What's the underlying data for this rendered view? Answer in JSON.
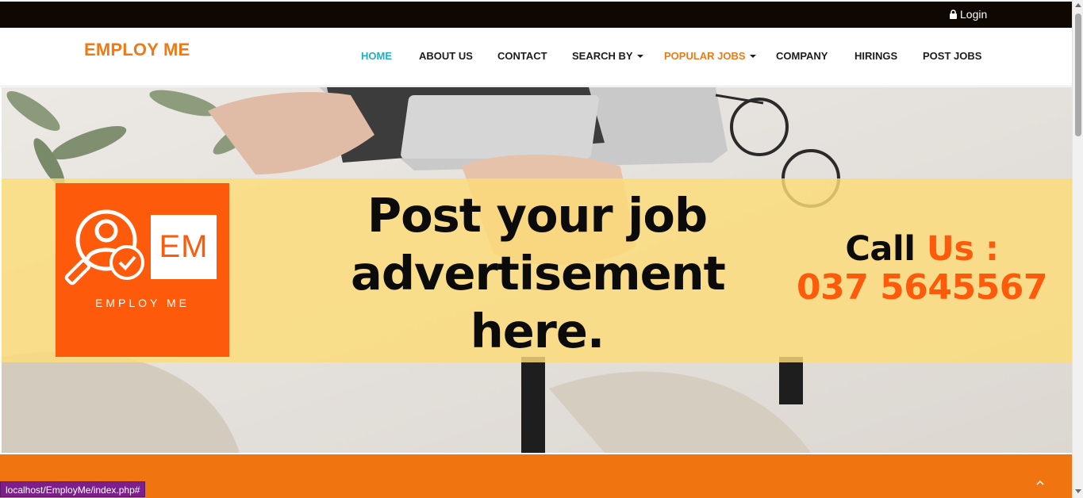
{
  "topbar": {
    "login_label": "Login",
    "login_icon": "lock-icon"
  },
  "navbar": {
    "brand": "EMPLOY ME",
    "items": [
      {
        "label": "HOME",
        "active": true,
        "dropdown": false
      },
      {
        "label": "ABOUT US",
        "active": false,
        "dropdown": false
      },
      {
        "label": "CONTACT",
        "active": false,
        "dropdown": false
      },
      {
        "label": "SEARCH BY",
        "active": false,
        "dropdown": true
      },
      {
        "label": "POPULAR JOBS",
        "active": false,
        "dropdown": true,
        "highlighted": true
      },
      {
        "label": "COMPANY",
        "active": false,
        "dropdown": false
      },
      {
        "label": "HIRINGS",
        "active": false,
        "dropdown": false
      },
      {
        "label": "POST JOBS",
        "active": false,
        "dropdown": false
      }
    ]
  },
  "hero": {
    "logo": {
      "initials": "EM",
      "text": "EMPLOY ME"
    },
    "headline": "Post your job advertisement here.",
    "call_prefix": "Call",
    "call_us": "Us :",
    "phone": "037 5645567"
  },
  "back_to_top_icon": "chevron-up-icon",
  "status_bar": {
    "url": "localhost/EmployMe/index.php#"
  },
  "colors": {
    "brand_orange": "#ee7a16",
    "logo_orange": "#fd5a0b",
    "active_nav": "#1faec2",
    "topbar": "#0e0702",
    "banner_yellow": "#fcdc78"
  }
}
